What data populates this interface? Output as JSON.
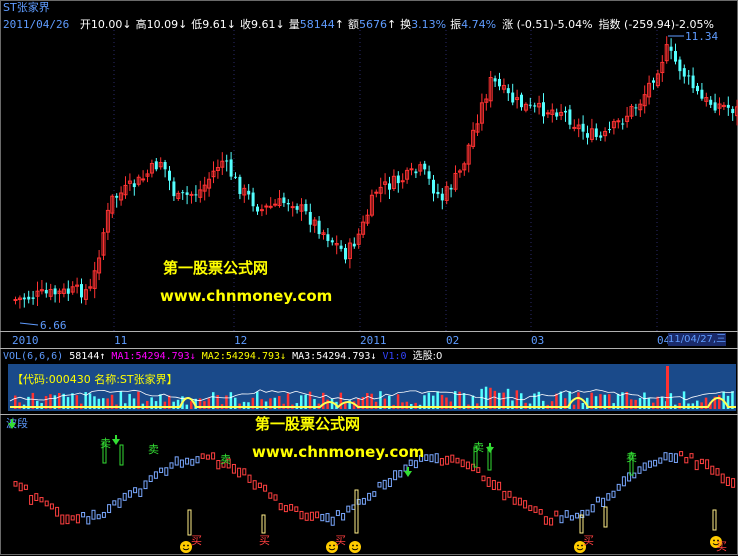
{
  "header": {
    "stock_name": "ST张家界",
    "date": "2011/04/26",
    "quote": [
      {
        "label": "开",
        "value": "10.00",
        "arrow": "↓"
      },
      {
        "label": "高",
        "value": "10.09",
        "arrow": "↓"
      },
      {
        "label": "低",
        "value": "9.61",
        "arrow": "↓"
      },
      {
        "label": "收",
        "value": "9.61",
        "arrow": "↓"
      },
      {
        "label": "量",
        "value": "58144",
        "arrow": "↑"
      },
      {
        "label": "额",
        "value": "5676",
        "arrow": "↑"
      },
      {
        "label": "换",
        "value": "3.13%",
        "arrow": ""
      },
      {
        "label": "振",
        "value": "4.74%",
        "arrow": ""
      }
    ],
    "change": "涨 (-0.51)-5.04%",
    "index": "指数 (-259.94)-2.05%"
  },
  "price_marks": {
    "high": "11.34",
    "low": "6.66"
  },
  "time_axis": [
    "2010",
    "11",
    "12",
    "2011",
    "02",
    "03",
    "04",
    "11/04/27,三"
  ],
  "volume_header": {
    "title": "VOL(6,6,6)",
    "vol": "58144",
    "vol_arrow": "↑",
    "ma1": "MA1:54294.793",
    "ma1_arrow": "↓",
    "ma2": "MA2:54294.793",
    "ma2_arrow": "↓",
    "ma3": "MA3:54294.793",
    "ma3_arrow": "↓",
    "v1": "V1:0",
    "select": "选股:0"
  },
  "code_name": "【代码:000430 名称:ST张家界】",
  "wave_panel": {
    "title": "波段",
    "buy": "买",
    "sell": "卖"
  },
  "watermark": {
    "line1": "第一股票公式网",
    "line2": "www.chnmoney.com"
  },
  "colors": {
    "up": "#ff3232",
    "down": "#54ffff",
    "header_blue": "#5f9cff",
    "ma1": "#ff00ff",
    "ma2": "#ffff00",
    "ma3": "#ffffff",
    "watermark": "#ffff00",
    "buy_icon": "#ffcc00",
    "sell_text": "#33dd33",
    "vol_bg": "#1a4a8a",
    "vol_bar": "#ffff55"
  },
  "icons": [
    "down-arrow-icon",
    "up-arrow-icon",
    "smiley-buy-icon"
  ]
}
